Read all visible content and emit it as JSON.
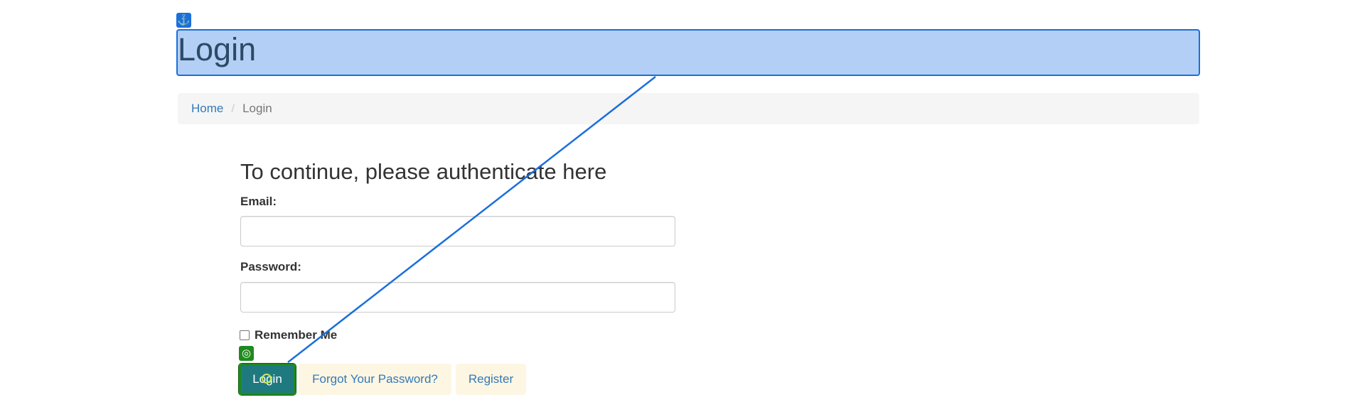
{
  "header": {
    "title": "Login",
    "anchor_icon": "anchor-icon",
    "highlight_color": "#b3cff5",
    "highlight_border": "#1a6fdb"
  },
  "breadcrumb": {
    "home": "Home",
    "separator": "/",
    "current": "Login"
  },
  "form": {
    "heading": "To continue, please authenticate here",
    "email_label": "Email:",
    "email_value": "",
    "password_label": "Password:",
    "password_value": "",
    "remember_label": "Remember Me",
    "remember_checked": false
  },
  "actions": {
    "login_label": "Login",
    "forgot_label": "Forgot Your Password?",
    "register_label": "Register",
    "target_icon": "target-icon"
  },
  "colors": {
    "link": "#337ab7",
    "login_button": "#1f7a80",
    "secondary_button": "#fdf6e3",
    "target_badge": "#1e8a1e"
  }
}
